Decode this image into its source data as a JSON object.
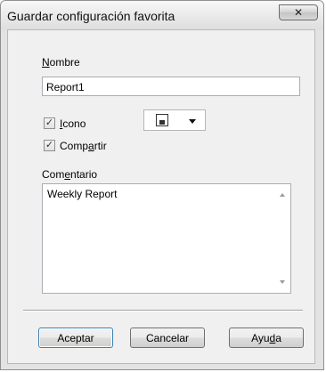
{
  "window": {
    "title": "Guardar configuración favorita",
    "close_glyph": "✕"
  },
  "form": {
    "name": {
      "label_access": "N",
      "label_rest": "ombre",
      "value": "Report1"
    },
    "icon": {
      "checked": true,
      "label_access": "I",
      "label_rest": "cono",
      "selected_icon": "floppy-disk-icon"
    },
    "share": {
      "checked": true,
      "label_pre": "Comp",
      "label_access": "a",
      "label_post": "rtir"
    },
    "comment": {
      "label_pre": "Com",
      "label_access": "e",
      "label_post": "ntario",
      "value": "Weekly Report"
    }
  },
  "buttons": {
    "ok": "Aceptar",
    "cancel": "Cancelar",
    "help_pre": "Ayu",
    "help_access": "d",
    "help_post": "a"
  },
  "glyphs": {
    "check": "✓"
  }
}
